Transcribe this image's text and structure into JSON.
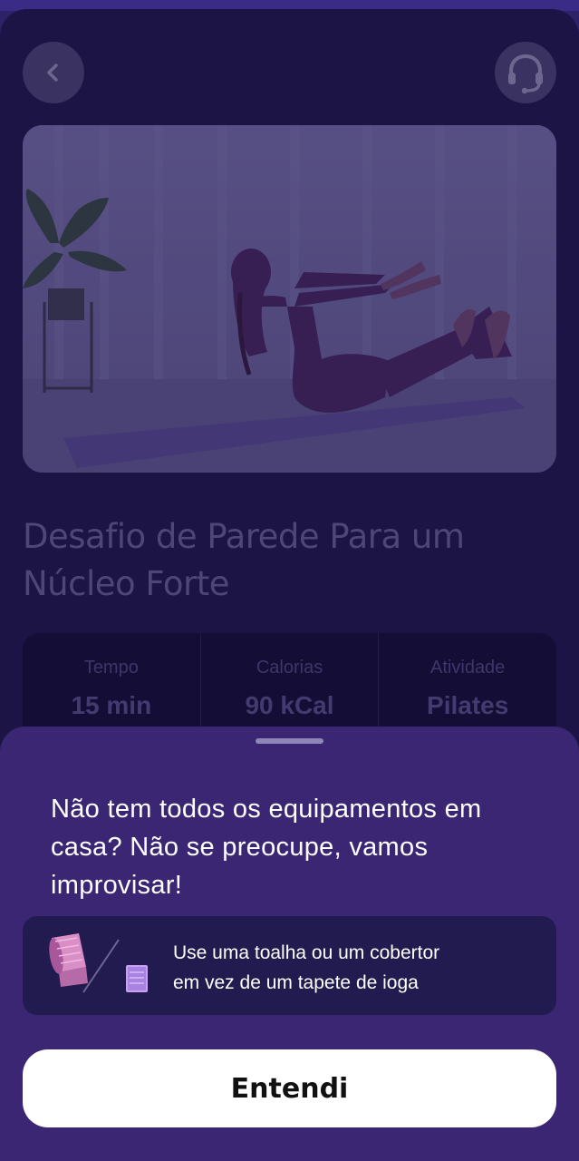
{
  "workout": {
    "title_line1": "Desafio de Parede Para um",
    "title_line2": "Núcleo Forte",
    "stats": [
      {
        "label": "Tempo",
        "value": "15 min"
      },
      {
        "label": "Calorias",
        "value": "90 kCal"
      },
      {
        "label": "Atividade",
        "value": "Pilates"
      }
    ]
  },
  "header": {
    "back_icon": "chevron-left-icon",
    "support_icon": "headset-icon"
  },
  "sheet": {
    "heading_line1": "Não tem todos os equipamentos em",
    "heading_line2": "casa? Não se preocupe, vamos",
    "heading_line3": "improvisar!",
    "tip": {
      "line1": "Use uma toalha ou um cobertor",
      "line2": "em vez de um tapete de ioga",
      "icons": [
        "yoga-mat-icon",
        "towel-icon"
      ]
    },
    "cta_label": "Entendi"
  },
  "colors": {
    "background": "#1b1445",
    "sheet": "#3a2672",
    "accent_button": "#ffffff"
  }
}
